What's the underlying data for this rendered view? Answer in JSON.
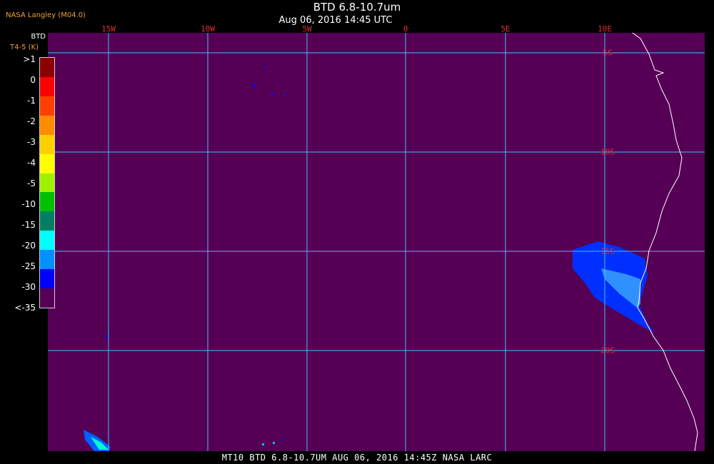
{
  "header": {
    "credit": "NASA Langley (M04.0)",
    "title": "BTD 6.8-10.7um",
    "subtitle": "Aug 06, 2016 14:45 UTC"
  },
  "legend": {
    "title": "BTD",
    "unit": "T4-5 (K)",
    "ticks": [
      ">1",
      "0",
      "-1",
      "-2",
      "-3",
      "-4",
      "-5",
      "-10",
      "-15",
      "-20",
      "-25",
      "-30",
      "<-35"
    ],
    "colors": [
      "#8b0000",
      "#ff0000",
      "#ff4000",
      "#ff8c00",
      "#ffd000",
      "#ffff00",
      "#a0f000",
      "#00c000",
      "#008060",
      "#00ffff",
      "#0090ff",
      "#0000ff",
      "#550055"
    ]
  },
  "map": {
    "background": "#550055",
    "grid_color": "#40c0ff",
    "coast_color": "#ffffff",
    "longitudes": [
      "15W",
      "10W",
      "5W",
      "0",
      "5E",
      "10E"
    ],
    "latitudes": [
      "5S",
      "10S",
      "15S",
      "20S"
    ]
  },
  "footer": {
    "text": "MT10   BTD 6.8-10.7UM    AUG 06, 2016 14:45Z   NASA LARC"
  }
}
